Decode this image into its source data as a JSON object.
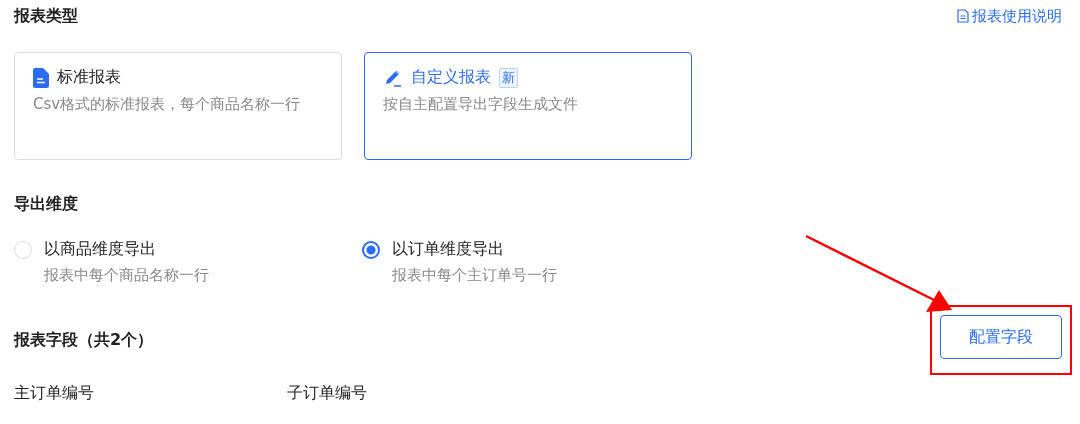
{
  "report_type": {
    "title": "报表类型",
    "help_link": "报表使用说明",
    "cards": [
      {
        "kind": "standard",
        "title": "标准报表",
        "description": "Csv格式的标准报表，每个商品名称一行",
        "selected": false
      },
      {
        "kind": "custom",
        "title": "自定义报表",
        "badge": "新",
        "description": "按自主配置导出字段生成文件",
        "selected": true
      }
    ]
  },
  "export_dimension": {
    "title": "导出维度",
    "options": [
      {
        "label": "以商品维度导出",
        "description": "报表中每个商品名称一行",
        "selected": false
      },
      {
        "label": "以订单维度导出",
        "description": "报表中每个主订单号一行",
        "selected": true
      }
    ]
  },
  "report_fields": {
    "title": "报表字段（共2个）",
    "button": "配置字段",
    "fields": [
      "主订单编号",
      "子订单编号"
    ]
  }
}
